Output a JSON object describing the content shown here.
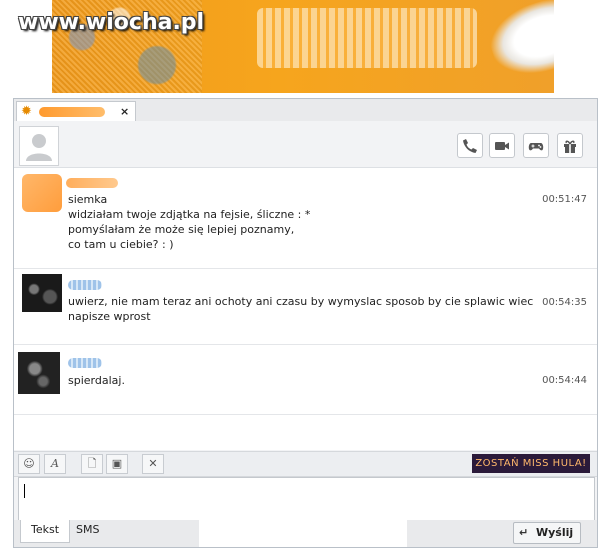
{
  "watermark": "www.wiocha.pl",
  "chat": {
    "messages": [
      {
        "lines": "siemka\nwidziałam twoje zdjątka na fejsie, śliczne : *\npomyślałam że może się lepiej poznamy,\nco tam u ciebie?  : )",
        "time": "00:51:47"
      },
      {
        "lines": "uwierz, nie mam teraz ani ochoty ani czasu by wymyslac sposob by cie splawic wiec\nnapisze wprost",
        "time": "00:54:35"
      },
      {
        "lines": "spierdalaj.",
        "time": "00:54:44"
      }
    ]
  },
  "toolbar": {
    "promo_label": "ZOSTAŃ MISS HULA!"
  },
  "bottom": {
    "tab_text": "Tekst",
    "tab_sms": "SMS",
    "send_label": "Wyślij"
  },
  "colors": {
    "accent_orange": "#f19a1b",
    "border": "#b9c0c8"
  },
  "icons": [
    "sun-icon",
    "close-icon",
    "phone-icon",
    "video-icon",
    "gamepad-icon",
    "gift-icon",
    "smiley-icon",
    "font-icon",
    "file-icon",
    "camera-icon",
    "tools-icon",
    "enter-icon"
  ]
}
